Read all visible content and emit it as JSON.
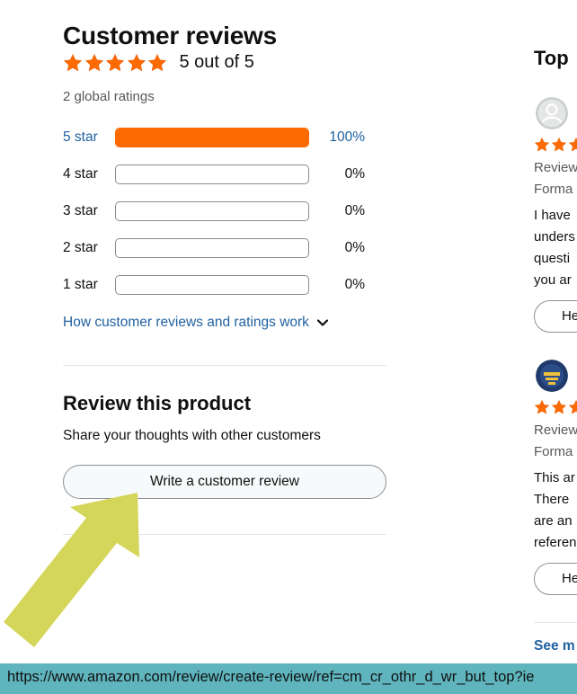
{
  "reviews": {
    "title": "Customer reviews",
    "rating_text": "5 out of 5",
    "rating_value": 5,
    "global_ratings": "2 global ratings",
    "histogram": [
      {
        "label": "5 star",
        "percent_text": "100%",
        "fraction": 1.0,
        "active": true
      },
      {
        "label": "4 star",
        "percent_text": "0%",
        "fraction": 0,
        "active": false
      },
      {
        "label": "3 star",
        "percent_text": "0%",
        "fraction": 0,
        "active": false
      },
      {
        "label": "2 star",
        "percent_text": "0%",
        "fraction": 0,
        "active": false
      },
      {
        "label": "1 star",
        "percent_text": "0%",
        "fraction": 0,
        "active": false
      }
    ],
    "how_link": "How customer reviews and ratings work"
  },
  "review_product": {
    "title": "Review this product",
    "subtitle": "Share your thoughts with other customers",
    "button_label": "Write a customer review"
  },
  "top_reviews": {
    "title": "Top",
    "review1": {
      "meta1": "Review",
      "meta2": "Forma",
      "lines": [
        "I have",
        "unders",
        "questi",
        "you ar"
      ],
      "helpful_label": "He"
    },
    "review2": {
      "avatar_text": "Bloom My Reviews Book",
      "meta1": "Review",
      "meta2": "Forma",
      "lines": [
        "This ar",
        "There",
        "are an",
        "referen"
      ],
      "helpful_label": "He"
    },
    "see_more": "See m"
  },
  "status_bar": {
    "url": "https://www.amazon.com/review/create-review/ref=cm_cr_othr_d_wr_but_top?ie"
  },
  "colors": {
    "star": "#fd6a02",
    "link": "#2162a1",
    "status_bar": "#5fb4bd",
    "annotation_arrow": "#d4d65a"
  }
}
